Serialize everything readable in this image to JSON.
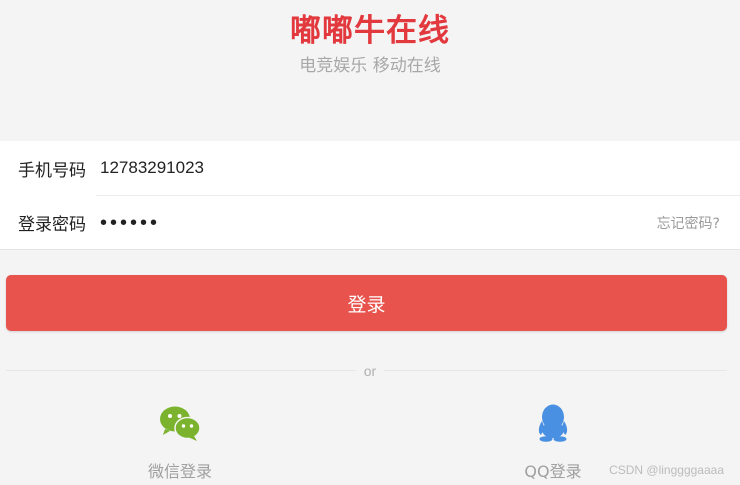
{
  "brand": {
    "title": "嘟嘟牛在线",
    "subtitle": "电竞娱乐 移动在线",
    "title_color": "#e2393e"
  },
  "form": {
    "phone_label": "手机号码",
    "phone_value": "12783291023",
    "password_label": "登录密码",
    "password_value": "••••••",
    "forgot_link": "忘记密码?"
  },
  "login_button": {
    "label": "登录",
    "color": "#e8534d"
  },
  "separator": {
    "text": "or"
  },
  "social": {
    "wechat": {
      "label": "微信登录",
      "icon": "wechat-icon",
      "color": "#7bb32e"
    },
    "qq": {
      "label": "QQ登录",
      "icon": "qq-icon",
      "color": "#4a90e2"
    }
  },
  "watermark": "CSDN @linggggaaaa"
}
